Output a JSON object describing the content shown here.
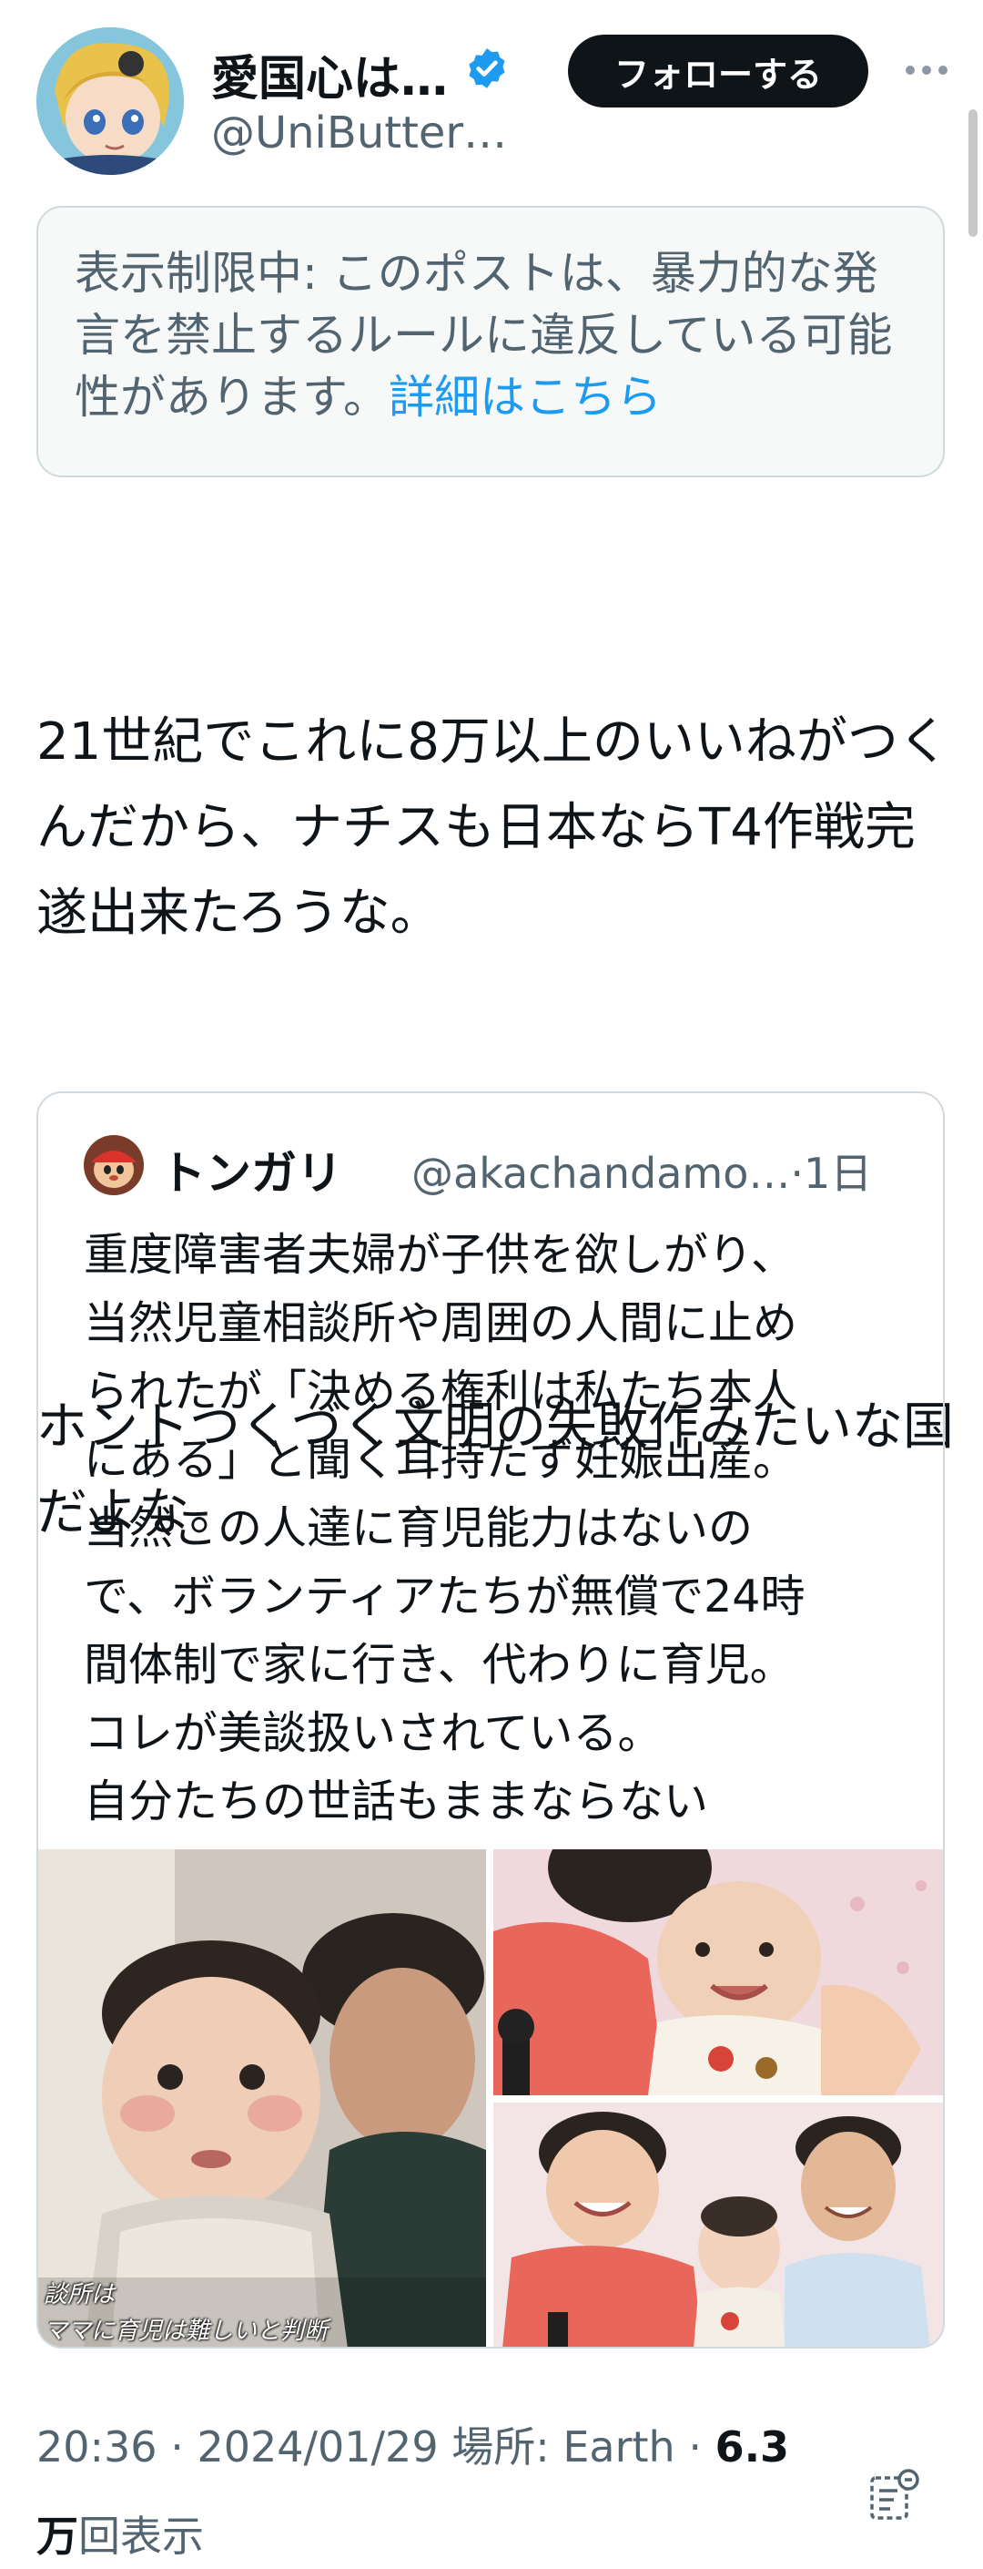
{
  "post": {
    "author": {
      "display_name": "愛国心は…",
      "handle": "@UniButter…",
      "verified": true
    },
    "follow_label": "フォローする",
    "notice": {
      "text": "表示制限中: このポストは、暴力的な発言を禁止するルールに違反している可能性があります。",
      "link": "詳細はこちら"
    },
    "text_paragraph_1": "21世紀でこれに8万以上のいいねがつくんだから、ナチスも日本ならT4作戦完遂出来たろうな。",
    "text_paragraph_2": "ホントつくづく文明の失敗作みたいな国だよな。",
    "quote": {
      "display_name": "トンガリ",
      "handle": "@akachandamo…",
      "time": "·1日",
      "lines": [
        "重度障害者夫婦が子供を欲しがり、",
        "当然児童相談所や周囲の人間に止め",
        "られたが「決める権利は私たち本人",
        "にある」と聞く耳持たず妊娠出産。",
        "当然この人達に育児能力はないの",
        "で、ボランティアたちが無償で24時",
        "間体制で家に行き、代わりに育児。",
        "コレが美談扱いされている。",
        "自分たちの世話もままならない"
      ],
      "media_caption_1": "談所は",
      "media_caption_2": "ママに育児は難しいと判断"
    },
    "meta": {
      "time": "20:36",
      "date": "2024/01/29",
      "location_label": "場所: Earth",
      "views_number": "6.3",
      "views_unit": "万",
      "views_label": "回表示"
    }
  },
  "colors": {
    "accent": "#1d9bf0",
    "text": "#0f1419",
    "secondary": "#536471",
    "border": "#cfd9de"
  },
  "icons": [
    "verified-badge-icon",
    "more-icon",
    "analytics-icon"
  ]
}
